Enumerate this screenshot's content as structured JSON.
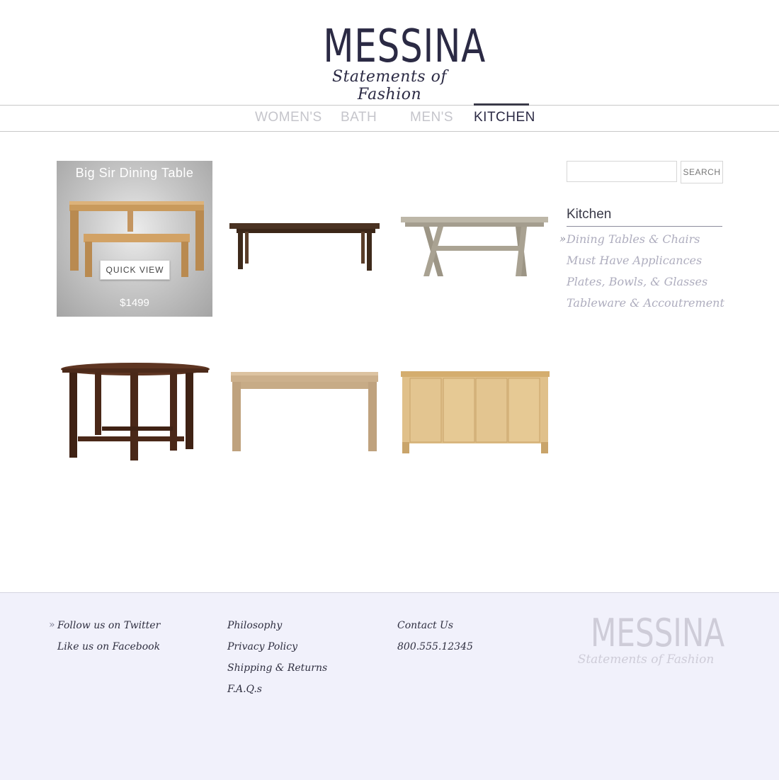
{
  "brand": {
    "name": "MESSINA",
    "tagline": "Statements of Fashion"
  },
  "nav": {
    "items": [
      {
        "label": "WOMEN'S",
        "active": false
      },
      {
        "label": "BATH",
        "active": false
      },
      {
        "label": "MEN'S",
        "active": false
      },
      {
        "label": "KITCHEN",
        "active": true
      }
    ]
  },
  "products": {
    "featured": {
      "title": "Big Sir Dining Table",
      "quick_view_label": "QUICK VIEW",
      "price": "$1499"
    }
  },
  "search": {
    "button_label": "SEARCH",
    "value": ""
  },
  "sidebar": {
    "heading": "Kitchen",
    "links": [
      {
        "label": "Dining Tables & Chairs",
        "active": true
      },
      {
        "label": "Must Have Applicances",
        "active": false
      },
      {
        "label": "Plates, Bowls, & Glasses",
        "active": false
      },
      {
        "label": "Tableware & Accoutrement",
        "active": false
      }
    ]
  },
  "footer": {
    "social": [
      "Follow us on Twitter",
      "Like us on Facebook"
    ],
    "info": [
      "Philosophy",
      "Privacy Policy",
      "Shipping & Returns",
      "F.A.Q.s"
    ],
    "contact": [
      "Contact Us",
      "800.555.12345"
    ],
    "logo": {
      "name": "MESSINA",
      "tagline": "Statements of Fashion"
    }
  },
  "colors": {
    "brand": "#2b2a44",
    "nav_inactive": "#c5c5cb",
    "sidebar_link": "#aeadbe",
    "footer_bg": "#f1f1fb"
  }
}
